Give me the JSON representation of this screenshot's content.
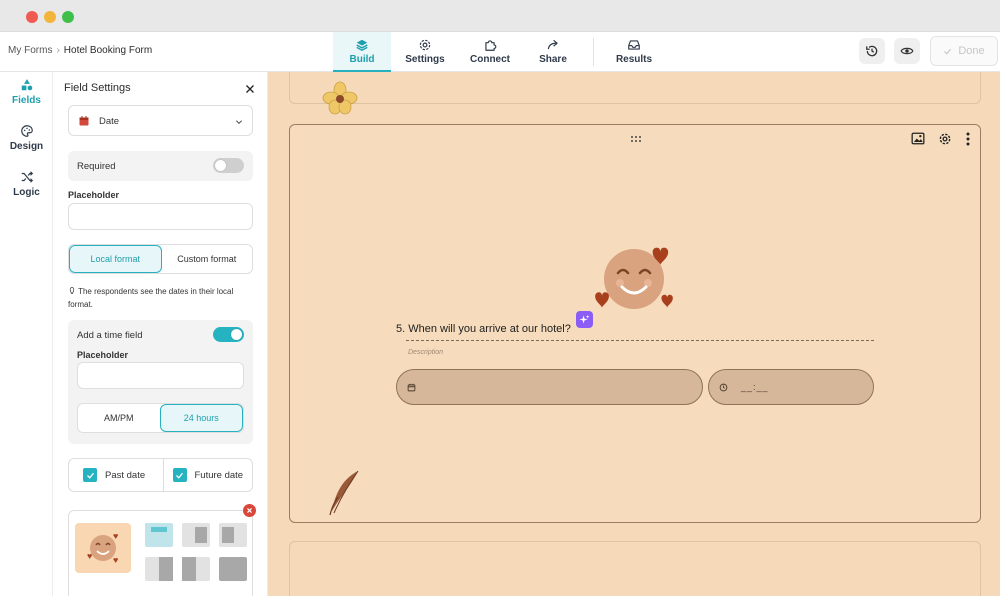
{
  "breadcrumb": {
    "root": "My Forms",
    "separator": "›",
    "current": "Hotel Booking Form"
  },
  "nav_tabs": [
    {
      "label": "Build",
      "icon": "layers-icon",
      "active": true
    },
    {
      "label": "Settings",
      "icon": "gear-icon",
      "active": false
    },
    {
      "label": "Connect",
      "icon": "puzzle-icon",
      "active": false
    },
    {
      "label": "Share",
      "icon": "share-arrow-icon",
      "active": false
    },
    {
      "label": "Results",
      "icon": "inbox-icon",
      "active": false
    }
  ],
  "toolbar": {
    "done_label": "Done"
  },
  "rail": [
    {
      "label": "Fields",
      "icon": "shapes-icon",
      "active": true
    },
    {
      "label": "Design",
      "icon": "palette-icon",
      "active": false
    },
    {
      "label": "Logic",
      "icon": "shuffle-icon",
      "active": false
    }
  ],
  "field_settings": {
    "title": "Field Settings",
    "field_type": "Date",
    "required_label": "Required",
    "required_on": false,
    "placeholder_label": "Placeholder",
    "placeholder_value": "",
    "format_options": [
      "Local format",
      "Custom format"
    ],
    "format_selected": "Local format",
    "format_note": "The respondents see the dates in their local format.",
    "time_field_label": "Add a time field",
    "time_field_on": true,
    "time_placeholder_label": "Placeholder",
    "time_placeholder_value": "",
    "hour_options": [
      "AM/PM",
      "24 hours"
    ],
    "hour_selected": "24 hours",
    "past_date_label": "Past date",
    "past_date_checked": true,
    "future_date_label": "Future date",
    "future_date_checked": true
  },
  "question": {
    "text": "5. When will you arrive at our hotel?",
    "description_placeholder": "Description",
    "time_placeholder": "__:__"
  },
  "colors": {
    "accent": "#25b3c2",
    "canvas_bg": "#f5d9b8",
    "input_bg": "#d6b79a",
    "heart": "#a8401e",
    "face": "#d9a37f"
  }
}
